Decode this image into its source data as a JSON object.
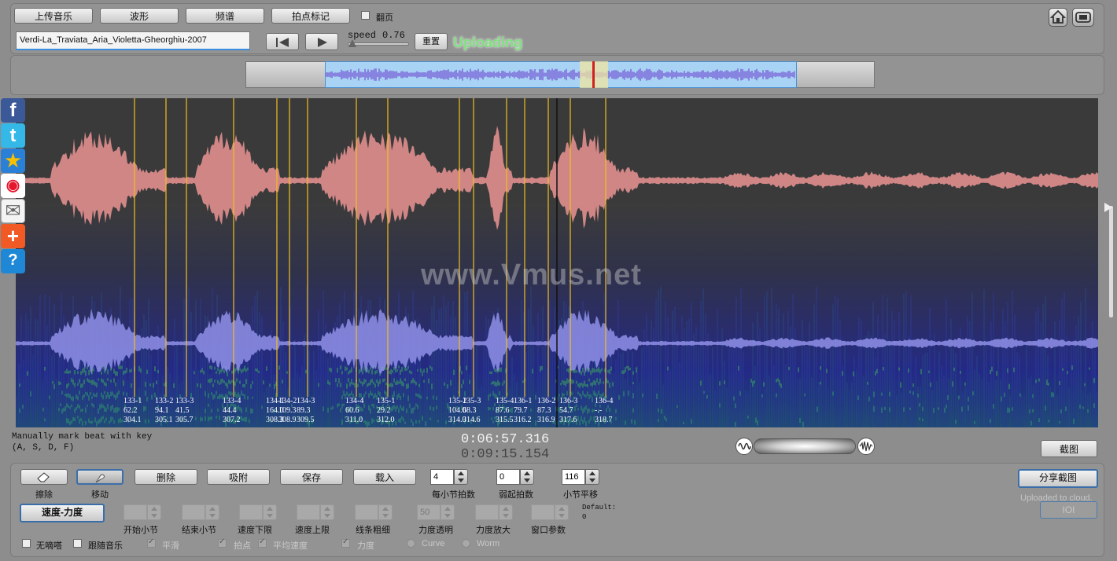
{
  "toolbar": {
    "upload": "上传音乐",
    "waveform": "波形",
    "spectrum": "频谱",
    "beat_mark": "拍点标记",
    "page_turn": "翻页"
  },
  "file": {
    "name": "Verdi-La_Traviata_Aria_Violetta-Gheorghiu-2007"
  },
  "playback": {
    "speed_label": "speed",
    "speed_value": "0.76",
    "speed_fraction": 0.08,
    "reset": "重置",
    "status": "Uploading"
  },
  "watermark": "www.Vmus.net",
  "beats": [
    {
      "t": "133-1",
      "a": "62.2",
      "b": "304.1"
    },
    {
      "t": "133-2",
      "a": "94.1",
      "b": "305.1"
    },
    {
      "t": "133-3",
      "a": "41.5",
      "b": "305.7"
    },
    {
      "t": "133-4",
      "a": "44.4",
      "b": "307.2"
    },
    {
      "t": "134-1",
      "a": "164.0",
      "b": "308.3"
    },
    {
      "t": "134-2",
      "a": "109.3",
      "b": "308.9"
    },
    {
      "t": "134-3",
      "a": "89.3",
      "b": "309.5"
    },
    {
      "t": "134-4",
      "a": "60.6",
      "b": "311.0"
    },
    {
      "t": "135-1",
      "a": "29.2",
      "b": "312.0"
    },
    {
      "t": "135-2",
      "a": "104.0",
      "b": "314.0"
    },
    {
      "t": "135-3",
      "a": "68.3",
      "b": "314.6"
    },
    {
      "t": "135-4",
      "a": "87.6",
      "b": "315.5"
    },
    {
      "t": "136-1",
      "a": "79.7",
      "b": "316.2"
    },
    {
      "t": "136-2",
      "a": "87.3",
      "b": "316.9"
    },
    {
      "t": "136-3",
      "a": "54.7",
      "b": "317.6"
    },
    {
      "t": "136-4",
      "a": "-.-",
      "b": "318.7"
    }
  ],
  "hint": {
    "line1": "Manually mark beat with key",
    "line2": "(A, S, D, F)"
  },
  "time": {
    "current": "0:06:57.316",
    "total": "0:09:15.154"
  },
  "screenshot": "截图",
  "controls": {
    "erase": "擦除",
    "move": "移动",
    "delete": "删除",
    "snap": "吸附",
    "save": "保存",
    "load": "载入",
    "beats_per_bar_value": "4",
    "beats_per_bar_label": "每小节拍数",
    "pickup_value": "0",
    "pickup_label": "弱起拍数",
    "bar_offset_value": "116",
    "bar_offset_label": "小节平移",
    "share": "分享截图",
    "uploaded": "Uploaded to cloud.",
    "ioi": "IOI",
    "speed_dynamics": "速度-力度",
    "start_bar": "开始小节",
    "end_bar": "结束小节",
    "speed_min": "速度下限",
    "speed_max": "速度上限",
    "line_width": "线条粗细",
    "dyn_alpha": "力度透明",
    "dyn_scale": "力度放大",
    "window_param": "窗口参数",
    "default_label": "Default:",
    "default_value": "0",
    "dyn_alpha_value": "50",
    "no_tick": "无嘀嗒",
    "follow_music": "跟随音乐",
    "smooth": "平滑",
    "beat_point": "拍点",
    "avg_speed": "平均速度",
    "dynamics": "力度",
    "curve": "Curve",
    "worm": "Worm"
  },
  "social": [
    "facebook-icon",
    "twitter-icon",
    "favorite-icon",
    "weibo-icon",
    "email-icon",
    "add-icon",
    "help-icon"
  ],
  "colors": {
    "waveform_top": "#d98a8a",
    "waveform_bottom": "#8f8fe8",
    "beat_line": "#f0c020",
    "status": "#7fe07f"
  }
}
